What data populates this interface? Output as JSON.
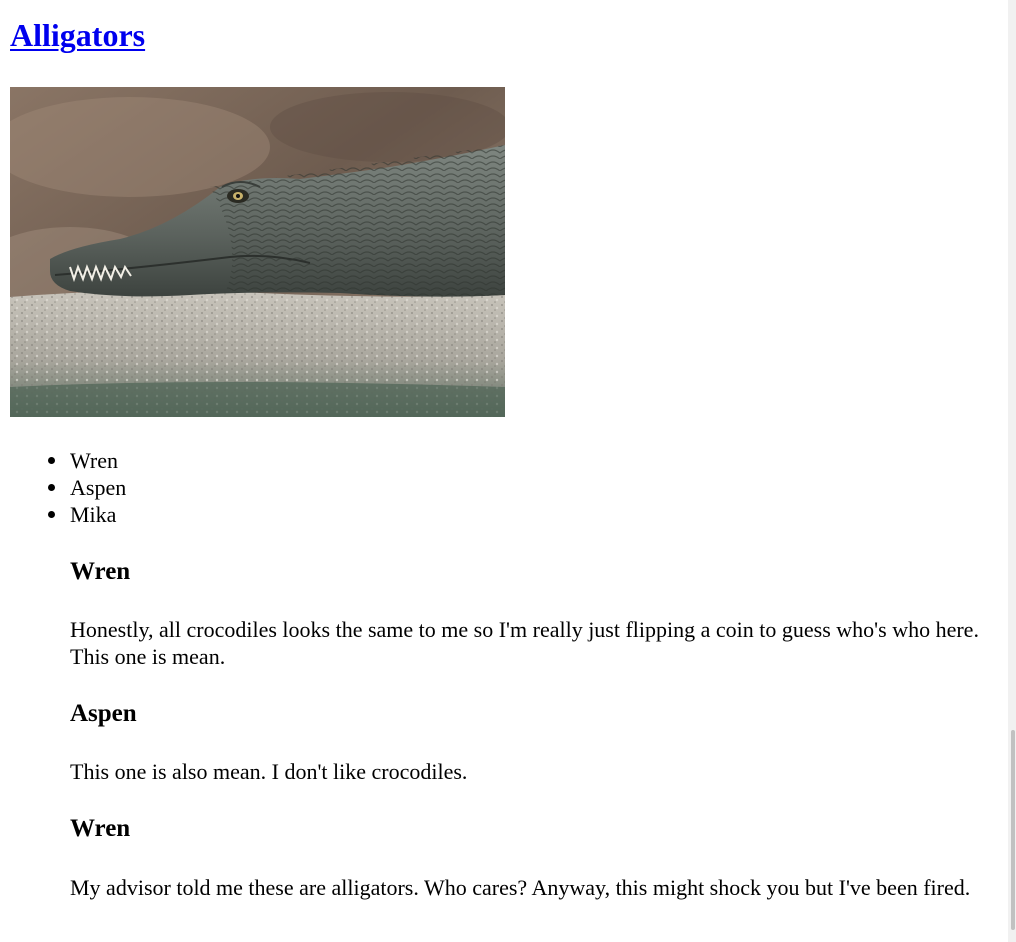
{
  "page": {
    "title": "Alligators",
    "image_alt": "crocodile resting on a rock",
    "link_color": "#0000ee"
  },
  "names": [
    "Wren",
    "Aspen",
    "Mika"
  ],
  "entries": [
    {
      "heading": "Wren",
      "text": "Honestly, all crocodiles looks the same to me so I'm really just flipping a coin to guess who's who here. This one is mean."
    },
    {
      "heading": "Aspen",
      "text": "This one is also mean. I don't like crocodiles."
    },
    {
      "heading": "Wren",
      "text": "My advisor told me these are alligators. Who cares? Anyway, this might shock you but I've been fired."
    }
  ]
}
